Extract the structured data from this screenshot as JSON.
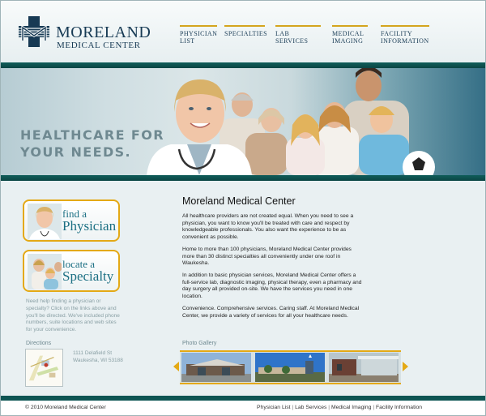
{
  "header": {
    "logo_title": "MORELAND",
    "logo_subtitle": "MEDICAL CENTER",
    "nav": [
      {
        "label": "PHYSICIAN\nLIST"
      },
      {
        "label": "SPECIALTIES"
      },
      {
        "label": "LAB SERVICES"
      },
      {
        "label": "MEDICAL\nIMAGING"
      },
      {
        "label": "FACILITY\nINFORMATION"
      }
    ]
  },
  "banner": {
    "tagline": "HEALTHCARE FOR\nYOUR NEEDS."
  },
  "sidebar": {
    "promo_physician": {
      "line1": "find a",
      "line2": "Physician"
    },
    "promo_specialty": {
      "line1": "locate a",
      "line2": "Specialty"
    },
    "help_text": "Need help finding a physician or specialty? Click on the links above and you'll be directed. We've included phone numbers, suite locations and web sites for your convenience.",
    "directions_heading": "Directions",
    "address": "1111 Delafield St\nWaukesha, WI 53188"
  },
  "main": {
    "title": "Moreland Medical Center",
    "paragraphs": [
      "All healthcare providers are not created equal. When you need to see a physician, you want to know you'll be treated with care and respect by knowledgeable professionals. You also want the experience to be as convenient as possible.",
      "Home to more than 100 physicians, Moreland Medical Center provides more than 30 distinct specialties all conveniently under one roof in Waukesha.",
      "In addition to basic physician services, Moreland Medical Center offers a full-service lab, diagnostic imaging, physical therapy, even a pharmacy and day surgery all provided on-site. We have the services you need in one location.",
      "Convenience. Comprehensive services. Caring staff. At Moreland Medical Center, we provide a variety of services for all your healthcare needs."
    ],
    "gallery_heading": "Photo Gallery"
  },
  "footer": {
    "copyright": "© 2010 Moreland Medical Center",
    "links": [
      "Physician List",
      "Lab Services",
      "Medical Imaging",
      "Facility Information"
    ],
    "separator": " | "
  },
  "colors": {
    "brand_navy": "#173a54",
    "brand_teal": "#0f5d5a",
    "accent_gold": "#e4a915",
    "promo_text": "#1b6f83"
  }
}
